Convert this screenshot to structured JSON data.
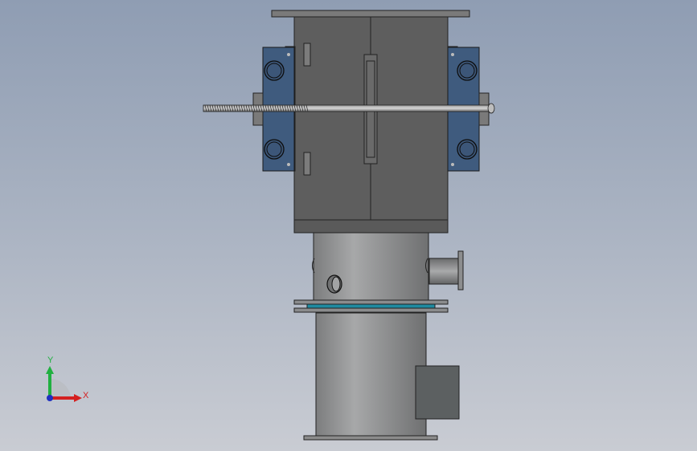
{
  "viewport": {
    "background_top": "#8f9db3",
    "background_bottom": "#c9ccd3"
  },
  "triad": {
    "x_label": "X",
    "y_label": "Y",
    "x_color": "#d42020",
    "y_color": "#20b040",
    "z_color": "#2030c0"
  },
  "model": {
    "body_color": "#5f5f5f",
    "pipe_color": "#8a8b8c",
    "bearing_color": "#3f5b7e",
    "gasket_color": "#8a1f22",
    "seal_color": "#1f8aa0"
  }
}
